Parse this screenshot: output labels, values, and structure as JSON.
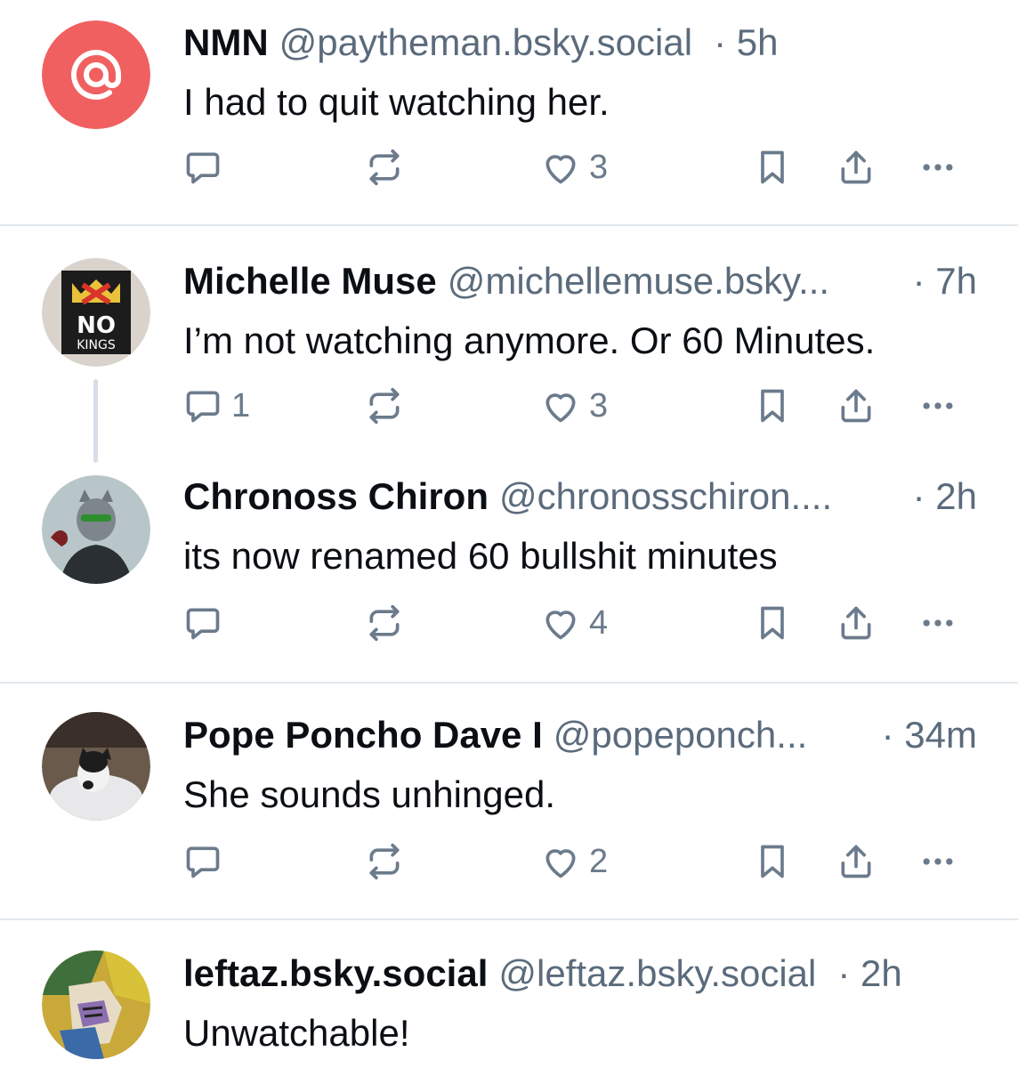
{
  "posts": [
    {
      "name": "NMN",
      "handle": "@paytheman.bsky.social",
      "time": "· 5h",
      "text": "I had to quit watching her.",
      "reply_count": "",
      "like_count": "3"
    },
    {
      "name": "Michelle Muse",
      "handle": "@michellemuse.bsky...",
      "time": "· 7h",
      "text": "I’m not watching anymore. Or 60 Minutes.",
      "reply_count": "1",
      "like_count": "3",
      "avatar_text_top": "NO",
      "avatar_text_bottom": "KINGS"
    },
    {
      "name": "Chronoss Chiron",
      "handle": "@chronosschiron....",
      "time": "· 2h",
      "text": "its now renamed 60 bullshit minutes",
      "reply_count": "",
      "like_count": "4"
    },
    {
      "name": "Pope Poncho Dave I",
      "handle": "@popeponch...",
      "time": "· 34m",
      "text": "She sounds unhinged.",
      "reply_count": "",
      "like_count": "2"
    },
    {
      "name": "leftaz.bsky.social",
      "handle": "@leftaz.bsky.social",
      "time": "· 2h",
      "text": "Unwatchable!"
    }
  ],
  "icons": [
    "at-sign-icon",
    "reply-icon",
    "repost-icon",
    "like-icon",
    "bookmark-icon",
    "share-icon",
    "more-icon"
  ],
  "colors": {
    "avatar_at_bg": "#f16060",
    "icon_gray": "#6b7b8c",
    "handle_gray": "#5b6b7c",
    "divider": "#e3e8ee",
    "thread_line": "#d7dee6"
  }
}
